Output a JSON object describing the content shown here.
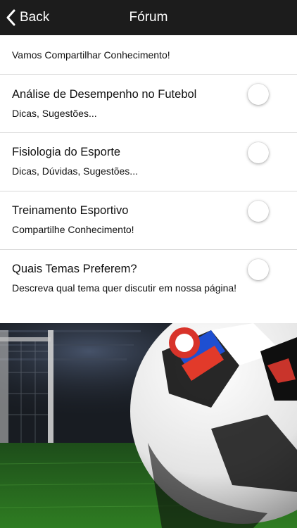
{
  "navbar": {
    "back_label": "Back",
    "title": "Fórum",
    "back_icon": "chevron-left-icon",
    "background": "#1c1c1c"
  },
  "intro": {
    "text": "Vamos Compartilhar Conhecimento!"
  },
  "forum_items": [
    {
      "title": "Análise de Desempenho no Futebol",
      "subtitle": "Dicas, Sugestões..."
    },
    {
      "title": "Fisiologia do Esporte",
      "subtitle": "Dicas, Dúvidas, Sugestões..."
    },
    {
      "title": "Treinamento Esportivo",
      "subtitle": "Compartilhe Conhecimento!"
    },
    {
      "title": "Quais Temas Preferem?",
      "subtitle": "Descreva qual tema quer discutir em nossa página!"
    }
  ],
  "hero": {
    "image": "soccer-ball-on-grass-photo"
  }
}
